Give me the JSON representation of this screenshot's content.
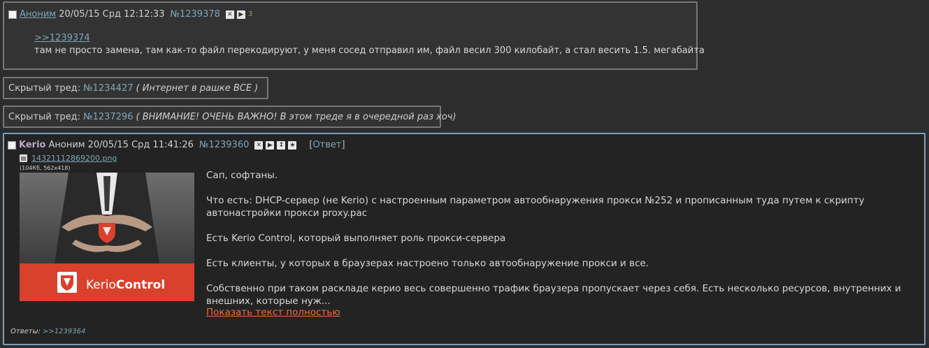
{
  "post1": {
    "name": "Аноним",
    "date": "20/05/15 Срд 12:12:33",
    "number": "№1239378",
    "count": "3",
    "reply_link": ">>1239374",
    "message": "там не просто замена, там как-то файл перекодируют, у меня сосед отправил им, файл весил 300 килобайт, а стал весить 1.5. мегабайта"
  },
  "hidden1": {
    "label": "Скрытый тред:",
    "number": "№1234427",
    "title": "( Интернет в рашке ВСЕ )"
  },
  "hidden2": {
    "label": "Скрытый тред:",
    "number": "№1237296",
    "title": "( ВНИМАНИЕ! ОЧЕНЬ ВАЖНО! В этом треде я в очередной раз хоч)"
  },
  "op": {
    "subject": "Kerio",
    "name": "Аноним",
    "date": "20/05/15 Срд 11:41:26",
    "number": "№1239360",
    "answer_open": "[",
    "answer_label": "Ответ",
    "answer_close": "]",
    "file_name": "14321112869200.png",
    "file_meta": "(104Кб, 562x418)",
    "image_brand_plain": "Kerio",
    "image_brand_bold": "Control",
    "paragraphs": [
      "Сап, софтаны.",
      "Что есть: DHCP-сервер (не Kerio) с настроенным параметром автообнаружения прокси №252 и прописанным туда путем к скрипту автонастройки прокси proxy.pac",
      "Есть Kerio Control, который выполняет роль прокси-сервера",
      "Есть клиенты, у которых в браузерах настроено только автообнаружение прокси и все.",
      "Собственно при таком раскладе керио весь совершенно трафик браузера пропускает через себя. Есть несколько ресурсов, внутренних и внешних, которые нуж..."
    ],
    "show_full": "Показать текст полностью",
    "replies_label": "Ответы:",
    "replies_link": ">>1239364"
  },
  "icons": {
    "hide": "close-icon",
    "play": "play-icon",
    "updown": "updown-icon",
    "star": "star-icon",
    "file": "file-icon"
  },
  "colors": {
    "background": "#2d2d2d",
    "link": "#7fa6b8",
    "op_border": "#7a9fbf",
    "show_full": "#e0703a",
    "subject": "#b9a9c9",
    "image_banner": "#d9412c"
  }
}
